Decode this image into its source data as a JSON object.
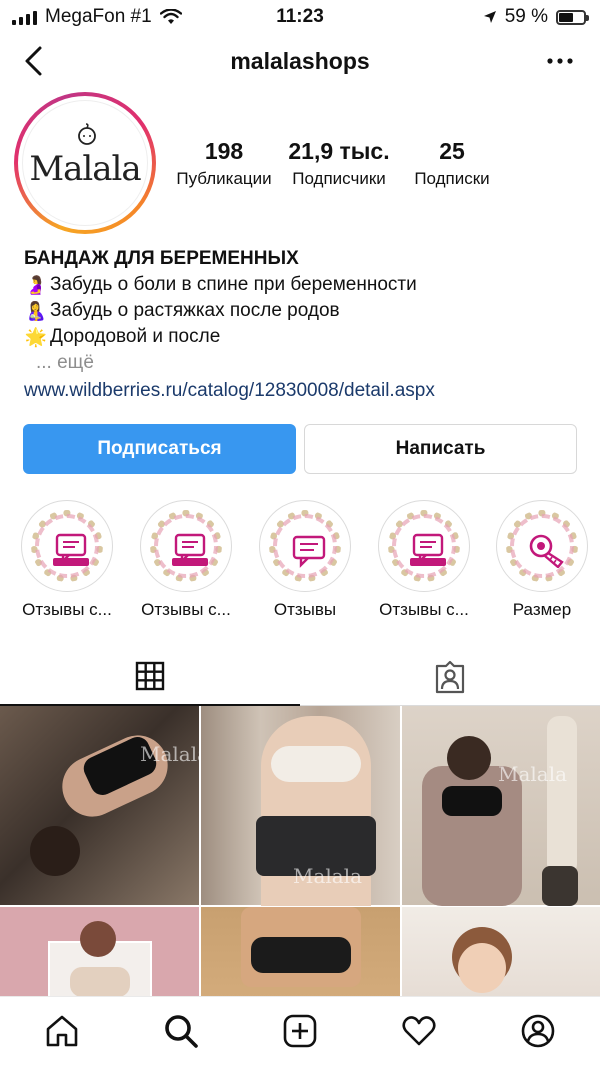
{
  "status_bar": {
    "carrier": "MegaFon #1",
    "time": "11:23",
    "battery": "59 %",
    "battery_level": 0.59
  },
  "nav": {
    "username": "malalashops"
  },
  "avatar": {
    "logo_text": "Malala"
  },
  "stats": [
    {
      "value": "198",
      "label": "Публикации"
    },
    {
      "value": "21,9 тыс.",
      "label": "Подписчики"
    },
    {
      "value": "25",
      "label": "Подписки"
    }
  ],
  "bio": {
    "name": "БАНДАЖ ДЛЯ БЕРЕМЕННЫХ",
    "lines": [
      {
        "emoji": "🤰",
        "text": "Забудь о боли в спине при беременности"
      },
      {
        "emoji": "🤱",
        "text": "Забудь о растяжках после родов"
      },
      {
        "emoji": "🌟",
        "text": "Дородовой и после"
      }
    ],
    "more": "... ещё",
    "link": "www.wildberries.ru/catalog/12830008/detail.aspx"
  },
  "buttons": {
    "follow": "Подписаться",
    "message": "Написать"
  },
  "highlights": [
    {
      "label": "Отзывы с...",
      "icon": "wildberries-chat-icon"
    },
    {
      "label": "Отзывы с...",
      "icon": "wildberries-chat-icon"
    },
    {
      "label": "Отзывы",
      "icon": "chat-icon"
    },
    {
      "label": "Отзывы с...",
      "icon": "wildberries-chat-icon"
    },
    {
      "label": "Размер",
      "icon": "measuring-tape-icon"
    }
  ],
  "watermark": "Malala",
  "colors": {
    "accent": "#3897f0",
    "highlight_pink": "#c2187a"
  }
}
